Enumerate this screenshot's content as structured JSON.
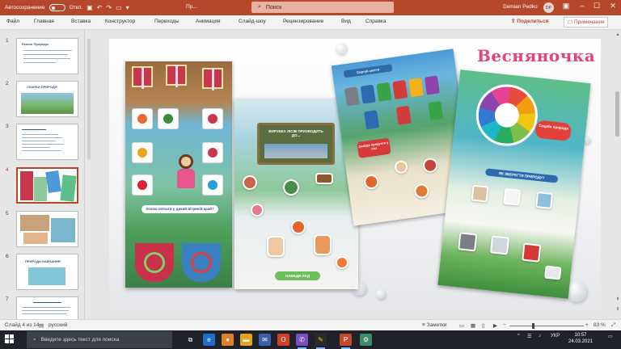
{
  "titlebar": {
    "autosave_label": "Автосохранение",
    "autosave_state": "Откл.",
    "doc_title": "Пр...",
    "search_placeholder": "Поиск",
    "user_name": "Demian Pedko",
    "user_initials": "DP"
  },
  "ribbon": {
    "tabs": [
      "Файл",
      "Главная",
      "Вставка",
      "Конструктор",
      "Переходы",
      "Анимация",
      "Слайд-шоу",
      "Рецензирование",
      "Вид",
      "Справка"
    ],
    "share_label": "Поделиться",
    "comments_label": "Примечания"
  },
  "slides_panel": {
    "active_index": 4,
    "items": [
      {
        "number": "1",
        "title": "Еколог Природы"
      },
      {
        "number": "2",
        "title": "СКАРБИ ПРИРОДИ"
      },
      {
        "number": "3",
        "title": ""
      },
      {
        "number": "4",
        "title": ""
      },
      {
        "number": "5",
        "title": ""
      },
      {
        "number": "6",
        "title": "ПРИРОДИ НАВЧАННЯ"
      },
      {
        "number": "7",
        "title": ""
      }
    ]
  },
  "slide": {
    "brand": "Весняночка",
    "photo1": {
      "banner": "Хочеш поїхати у дикий вітряній край?"
    },
    "photo2": {
      "sign_text": "ВИРУБКА ЛІСІВ ПРИЗВОДИТЬ ДО...",
      "button": "НАВЕДИ ЛАД"
    },
    "photo3": {
      "title": "Сортуй сміття",
      "bubble": "Знайди продукти у лісі"
    },
    "photo4": {
      "cloud": "Скарби природи",
      "question": "ЯК ЗБЕРЕГТИ ПРИРОДУ?"
    }
  },
  "statusbar": {
    "slide_info": "Слайд 4 из 14",
    "language": "русский",
    "notes_label": "Заметки",
    "zoom": "83 %",
    "zoom_level": 0.83
  },
  "taskbar": {
    "search_placeholder": "Введите здесь текст для поиска",
    "language": "УКР",
    "time": "10:57",
    "date": "24.03.2021"
  },
  "colors": {
    "accent": "#b7472a",
    "brand_pink": "#e0457b"
  }
}
